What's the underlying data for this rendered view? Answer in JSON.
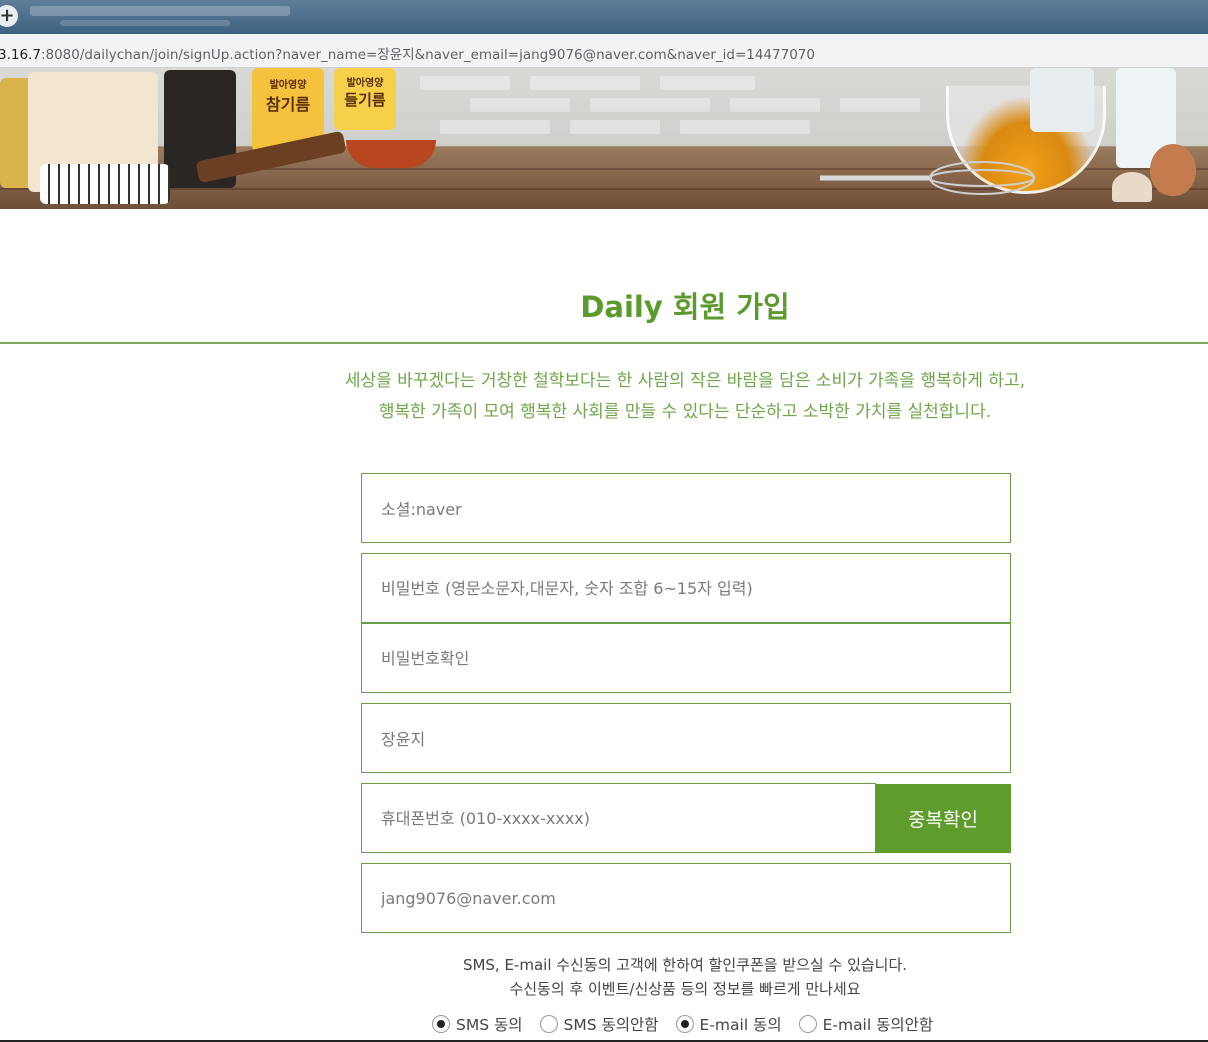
{
  "browser": {
    "new_tab_glyph": "+",
    "url_host": "3.16.7",
    "url_rest": ":8080/dailychan/join/signUp.action?naver_name=장윤지&naver_email=jang9076@naver.com&naver_id=14477070"
  },
  "banner": {
    "jar_labels": [
      "참기름",
      "들기름"
    ],
    "jar_top_labels": [
      "발아영양",
      "발아영양"
    ]
  },
  "page": {
    "title": "Daily 회원 가입",
    "intro_line1": "세상을 바꾸겠다는 거창한 철학보다는 한 사람의 작은 바람을 담은 소비가 가족을 행복하게 하고,",
    "intro_line2": "행복한 가족이 모여 행복한 사회를 만들 수 있다는 단순하고 소박한 가치를 실천합니다."
  },
  "form": {
    "social_value": "소셜:naver",
    "password_placeholder": "비밀번호 (영문소문자,대문자, 숫자 조합 6~15자 입력)",
    "password_confirm_placeholder": "비밀번호확인",
    "name_value": "장윤지",
    "phone_placeholder": "휴대폰번호 (010-xxxx-xxxx)",
    "duplicate_check_label": "중복확인",
    "email_value": "jang9076@naver.com"
  },
  "consent": {
    "notice_line1": "SMS, E-mail 수신동의 고객에 한하여 할인쿠폰을 받으실 수 있습니다.",
    "notice_line2": "수신동의 후 이벤트/신상품 등의 정보를 빠르게 만나세요",
    "sms_agree": "SMS 동의",
    "sms_disagree": "SMS 동의안함",
    "email_agree": "E-mail 동의",
    "email_disagree": "E-mail 동의안함",
    "sms_selected": "SMS 동의",
    "email_selected": "E-mail 동의"
  },
  "colors": {
    "accent_green": "#5e9c2c",
    "title_green": "#5b9a2c",
    "intro_green": "#6fa64a"
  }
}
